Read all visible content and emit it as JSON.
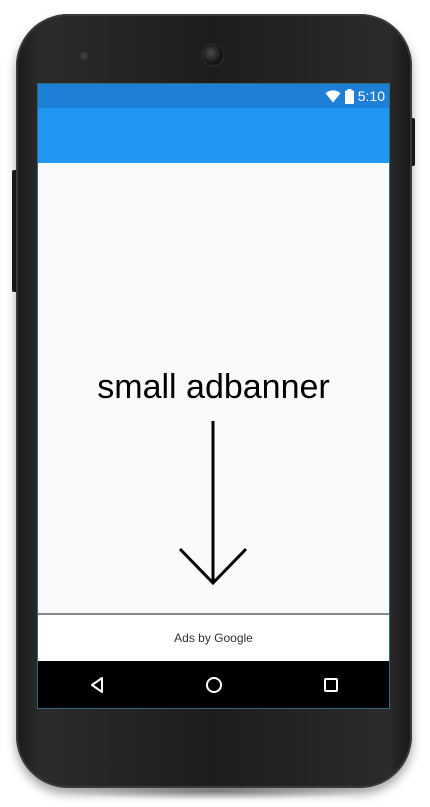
{
  "status_bar": {
    "time": "5:10",
    "icons": [
      "wifi-icon",
      "battery-icon"
    ]
  },
  "annotation": {
    "text": "small adbanner"
  },
  "ad_banner": {
    "label": "Ads by Google"
  },
  "nav_bar": {
    "buttons": [
      "back-icon",
      "home-icon",
      "recents-icon"
    ]
  },
  "colors": {
    "status_bar": "#1e7fd6",
    "app_bar": "#2196f3",
    "content_bg": "#fafafa",
    "nav_bar": "#000000"
  }
}
